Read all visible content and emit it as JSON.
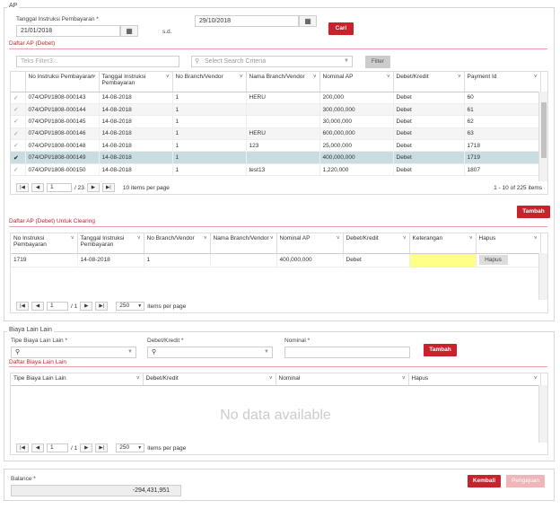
{
  "ap": {
    "legend": "AP",
    "tanggal_label": "Tanggal Instruksi Pembayaran *",
    "date_from": "21/01/2018",
    "sd_label": "s.d.",
    "date_to": "29/10/2018",
    "cari_label": "Cari",
    "daftar_title": "Daftar AP (Debet)",
    "filter_placeholder": "Teks Filter3...",
    "search_criteria_placeholder": "Select Search Criteria",
    "filter_button": "Filter",
    "columns": [
      "No Instruksi Pembayaran",
      "Tanggal Instruksi Pembayaran",
      "No Branch/Vendor",
      "Nama Branch/Vendor",
      "Nominal AP",
      "Debet/Kredit",
      "Payment Id"
    ],
    "rows": [
      {
        "no": "074/OPI/1808-000143",
        "tgl": "14-08-2018",
        "branch": "1",
        "nama": "HERU",
        "nominal": "200,000",
        "dk": "Debet",
        "pid": "60"
      },
      {
        "no": "074/OPI/1808-000144",
        "tgl": "14-08-2018",
        "branch": "1",
        "nama": "",
        "nominal": "300,000,000",
        "dk": "Debet",
        "pid": "61"
      },
      {
        "no": "074/OPI/1808-000145",
        "tgl": "14-08-2018",
        "branch": "1",
        "nama": "",
        "nominal": "30,000,000",
        "dk": "Debet",
        "pid": "62"
      },
      {
        "no": "074/OPI/1808-000146",
        "tgl": "14-08-2018",
        "branch": "1",
        "nama": "HERU",
        "nominal": "600,000,000",
        "dk": "Debet",
        "pid": "63"
      },
      {
        "no": "074/OPI/1808-000148",
        "tgl": "14-08-2018",
        "branch": "1",
        "nama": "123",
        "nominal": "25,000,000",
        "dk": "Debet",
        "pid": "1718"
      },
      {
        "no": "074/OPI/1808-000149",
        "tgl": "14-08-2018",
        "branch": "1",
        "nama": "",
        "nominal": "400,000,000",
        "dk": "Debet",
        "pid": "1719"
      },
      {
        "no": "074/OPI/1808-000150",
        "tgl": "14-08-2018",
        "branch": "1",
        "nama": "test13",
        "nominal": "1,220,000",
        "dk": "Debet",
        "pid": "1807"
      }
    ],
    "pager_page": "1",
    "pager_total": "/ 23",
    "items_per_page": "10 items per page",
    "range_text": "1 - 10 of 225 items"
  },
  "clearing": {
    "tambah_label": "Tambah",
    "title": "Daftar AP (Debet) Untuk Clearing",
    "columns": [
      "No Instruksi Pembayaran",
      "Tanggal Instruksi Pembayaran",
      "No Branch/Vendor",
      "Nama Branch/Vendor",
      "Nominal AP",
      "Debet/Kredit",
      "Keterangan",
      "Hapus"
    ],
    "row": {
      "no": "1719",
      "tgl": "14-08-2018",
      "branch": "1",
      "nama": "",
      "nominal": "400,000,000",
      "dk": "Debet",
      "ket": "",
      "hapus": "Hapus"
    },
    "pager_page": "1",
    "pager_total": "/ 1",
    "page_size": "250",
    "items_per_page": "items per page"
  },
  "biaya": {
    "legend": "Biaya Lain Lain",
    "tipe_label": "Tipe Biaya Lain Lain *",
    "dk_label": "Debet/Kredit *",
    "nominal_label": "Nominal *",
    "tambah_label": "Tambah",
    "title": "Daftar Biaya Lain Lain",
    "columns": [
      "Tipe Biaya Lain Lain",
      "Debet/Kredit",
      "Nominal",
      "Hapus"
    ],
    "empty_text": "No data available",
    "pager_page": "1",
    "pager_total": "/ 1",
    "page_size": "250",
    "items_per_page": "items per page"
  },
  "footer": {
    "balance_label": "Balance *",
    "balance_value": "-294,431,951",
    "kembali_label": "Kembali",
    "pengajuan_label": "Pengajuan"
  },
  "colors": {
    "accent": "#c8232c",
    "selected_row": "#c9dde0",
    "highlight_cell": "#ffff88"
  }
}
